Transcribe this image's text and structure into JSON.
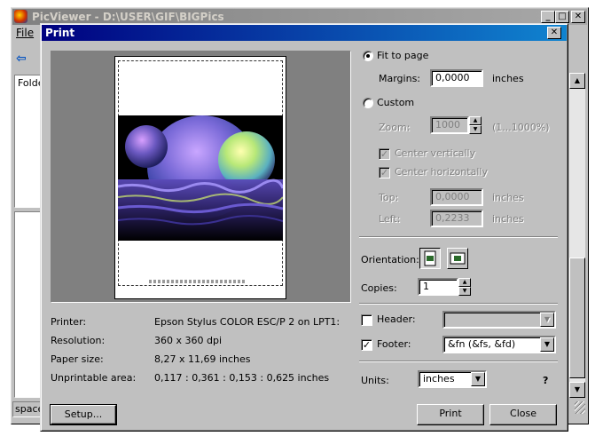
{
  "background_window": {
    "title": "PicViewer - D:\\USER\\GIF\\BIGPics",
    "menu_file": "File",
    "folders_label": "Folde",
    "status_text": "space",
    "min_glyph": "_",
    "max_glyph": "□",
    "close_glyph": "✕"
  },
  "dialog": {
    "title": "Print",
    "close_glyph": "✕"
  },
  "scaling": {
    "fit_to_page_label": "Fit to page",
    "fit_to_page_selected": true,
    "margins_label": "Margins:",
    "margins_value": "0,0000",
    "margins_unit": "inches",
    "custom_label": "Custom",
    "zoom_label": "Zoom:",
    "zoom_value": "1000",
    "zoom_range": "(1...1000%)",
    "center_vertically_label": "Center vertically",
    "center_horizontally_label": "Center horizontally",
    "top_label": "Top:",
    "top_value": "0,0000",
    "top_unit": "inches",
    "left_label": "Left:",
    "left_value": "0,2233",
    "left_unit": "inches"
  },
  "orientation": {
    "label": "Orientation:"
  },
  "copies": {
    "label": "Copies:",
    "value": "1"
  },
  "header": {
    "label": "Header:",
    "checked": false,
    "value": ""
  },
  "footer": {
    "label": "Footer:",
    "checked": true,
    "value": "&fn (&fs, &fd)"
  },
  "units": {
    "label": "Units:",
    "value": "inches",
    "help": "?"
  },
  "printer_info": {
    "printer_label": "Printer:",
    "printer_value": "Epson Stylus COLOR ESC/P 2 on LPT1:",
    "resolution_label": "Resolution:",
    "resolution_value": "360 x 360 dpi",
    "paper_label": "Paper size:",
    "paper_value": "8,27 x 11,69 inches",
    "unprintable_label": "Unprintable area:",
    "unprintable_value": "0,117 : 0,361 : 0,153 : 0,625 inches"
  },
  "buttons": {
    "setup": "Setup...",
    "print": "Print",
    "close": "Close"
  },
  "glyphs": {
    "check": "✓",
    "down": "▼",
    "up": "▲",
    "back_arrow": "⇦"
  }
}
